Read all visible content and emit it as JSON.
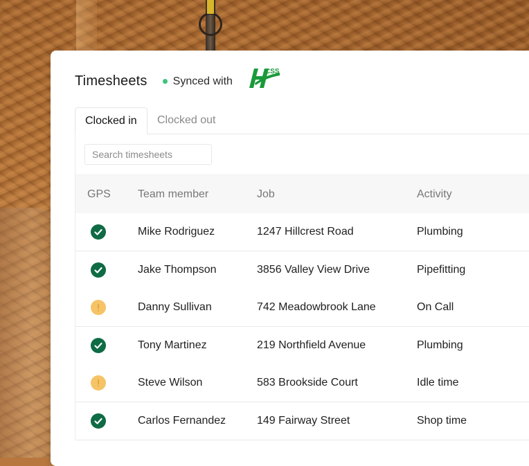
{
  "header": {
    "title": "Timesheets",
    "sync_label": "Synced with",
    "logo_text": "HCSS",
    "colors": {
      "sync_dot": "#3bc47c",
      "logo": "#1a9a3a"
    }
  },
  "tabs": [
    {
      "label": "Clocked in",
      "active": true
    },
    {
      "label": "Clocked out",
      "active": false
    }
  ],
  "search": {
    "placeholder": "Search timesheets",
    "value": ""
  },
  "table": {
    "columns": [
      "GPS",
      "Team member",
      "Job",
      "Activity"
    ],
    "rows": [
      {
        "gps": "ok",
        "gps_icon": "check-circle-icon",
        "member": "Mike Rodriguez",
        "job": "1247 Hillcrest Road",
        "activity": "Plumbing"
      },
      {
        "gps": "ok",
        "gps_icon": "check-circle-icon",
        "member": "Jake Thompson",
        "job": "3856 Valley View Drive",
        "activity": "Pipefitting"
      },
      {
        "gps": "warn",
        "gps_icon": "warning-circle-icon",
        "member": "Danny Sullivan",
        "job": "742 Meadowbrook Lane",
        "activity": "On Call"
      },
      {
        "gps": "ok",
        "gps_icon": "check-circle-icon",
        "member": "Tony Martinez",
        "job": "219 Northfield Avenue",
        "activity": "Plumbing"
      },
      {
        "gps": "warn",
        "gps_icon": "warning-circle-icon",
        "member": "Steve Wilson",
        "job": "583 Brookside Court",
        "activity": "Idle time"
      },
      {
        "gps": "ok",
        "gps_icon": "check-circle-icon",
        "member": "Carlos Fernandez",
        "job": "149 Fairway Street",
        "activity": "Shop time"
      }
    ],
    "status_colors": {
      "ok": "#0f6b44",
      "warn": "#f6c466"
    }
  }
}
